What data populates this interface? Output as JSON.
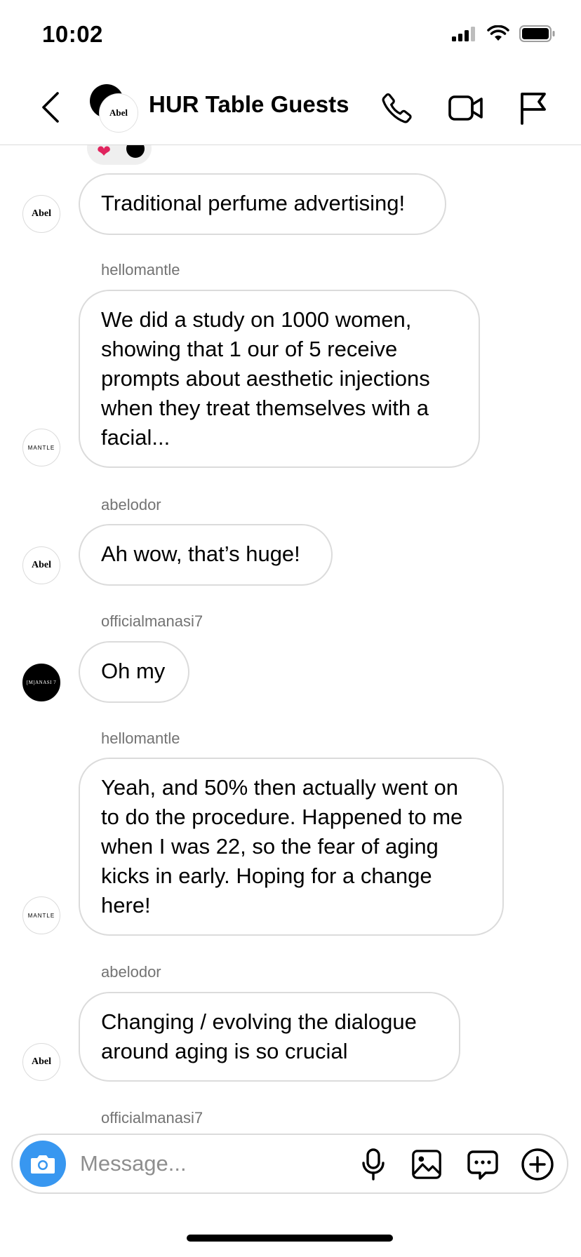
{
  "status_bar": {
    "time": "10:02",
    "icons": [
      "signal-icon",
      "wifi-icon",
      "battery-icon"
    ]
  },
  "header": {
    "title": "HUR Table Guests",
    "avatar_label": "Abel",
    "icons": [
      "back-arrow-icon",
      "phone-icon",
      "video-camera-icon",
      "flag-icon"
    ]
  },
  "reaction": {
    "emojis": [
      "heart-icon",
      "black-circle-icon"
    ]
  },
  "messages": [
    {
      "sender": "",
      "avatar_text": "Abel",
      "text": "Traditional perfume advertising!"
    },
    {
      "sender": "hellomantle",
      "avatar_text": "MANTLE",
      "text": "We did a study on 1000 women, showing that 1 our of 5 receive prompts about aesthetic injections when they treat themselves with a facial..."
    },
    {
      "sender": "abelodor",
      "avatar_text": "Abel",
      "text": "Ah wow, that’s huge!"
    },
    {
      "sender": "officialmanasi7",
      "avatar_text": "[M]ANASI 7",
      "text": "Oh my"
    },
    {
      "sender": "hellomantle",
      "avatar_text": "MANTLE",
      "text": "Yeah, and 50% then actually went on to do the procedure. Happened to me when I was 22, so the fear of aging kicks in early. Hoping for a change here!"
    },
    {
      "sender": "abelodor",
      "avatar_text": "Abel",
      "text": "Changing / evolving the dialogue around aging is so crucial"
    },
    {
      "sender": "officialmanasi7"
    }
  ],
  "composer": {
    "placeholder": "Message...",
    "value": "",
    "icons": [
      "camera-icon",
      "microphone-icon",
      "gallery-icon",
      "sticker-icon",
      "plus-icon"
    ]
  },
  "colors": {
    "accent": "#3897f0",
    "bubble_border": "#dbdbdb",
    "secondary_text": "#737373"
  }
}
